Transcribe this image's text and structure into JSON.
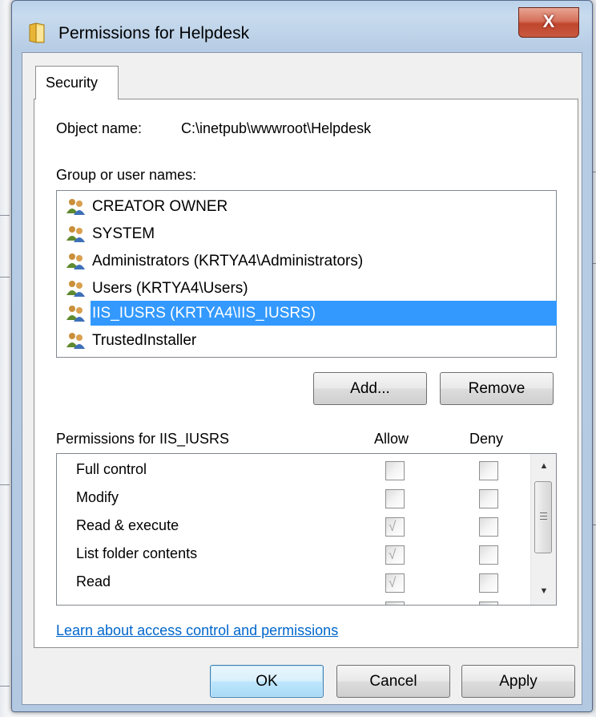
{
  "window": {
    "title": "Permissions for Helpdesk",
    "close_label": "X"
  },
  "tabs": [
    {
      "label": "Security"
    }
  ],
  "object": {
    "label": "Object name:",
    "value": "C:\\inetpub\\wwwroot\\Helpdesk"
  },
  "groups": {
    "label": "Group or user names:",
    "items": [
      {
        "name": "CREATOR OWNER",
        "icon": "users-icon"
      },
      {
        "name": "SYSTEM",
        "icon": "users-icon"
      },
      {
        "name": "Administrators (KRTYA4\\Administrators)",
        "icon": "users-icon"
      },
      {
        "name": "Users (KRTYA4\\Users)",
        "icon": "users-icon"
      },
      {
        "name": "IIS_IUSRS (KRTYA4\\IIS_IUSRS)",
        "icon": "users-icon",
        "selected": true
      },
      {
        "name": "TrustedInstaller",
        "icon": "users-icon"
      }
    ],
    "add_button": "Add...",
    "remove_button": "Remove"
  },
  "permissions": {
    "label": "Permissions for IIS_IUSRS",
    "allow_header": "Allow",
    "deny_header": "Deny",
    "rows": [
      {
        "name": "Full control",
        "allow": false,
        "deny": false
      },
      {
        "name": "Modify",
        "allow": false,
        "deny": false
      },
      {
        "name": "Read & execute",
        "allow": true,
        "deny": false
      },
      {
        "name": "List folder contents",
        "allow": true,
        "deny": false
      },
      {
        "name": "Read",
        "allow": true,
        "deny": false
      }
    ]
  },
  "learn_link": "Learn about access control and permissions",
  "footer": {
    "ok": "OK",
    "cancel": "Cancel",
    "apply": "Apply"
  },
  "colors": {
    "selection": "#3399ff",
    "link": "#0066cc",
    "close_button": "#c8492f"
  }
}
